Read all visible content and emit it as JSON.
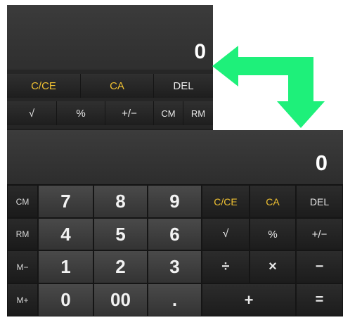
{
  "top_calc": {
    "display_value": "0",
    "row1": [
      "C/CE",
      "CA",
      "DEL"
    ],
    "row2": [
      "√",
      "%",
      "+/−",
      "CM",
      "RM"
    ]
  },
  "main_calc": {
    "display_value": "0",
    "memory": [
      "CM",
      "RM",
      "M−",
      "M+"
    ],
    "digits": {
      "r1": [
        "7",
        "8",
        "9"
      ],
      "r2": [
        "4",
        "5",
        "6"
      ],
      "r3": [
        "1",
        "2",
        "3"
      ],
      "r4": [
        "0",
        "00",
        "."
      ]
    },
    "functions": {
      "r1": [
        "C/CE",
        "CA",
        "DEL"
      ],
      "r2": [
        "√",
        "%",
        "+/−"
      ],
      "r3": [
        "÷",
        "×",
        "−"
      ],
      "r4": [
        "+",
        "="
      ]
    }
  },
  "colors": {
    "accent_yellow": "#f1c232",
    "arrow_green": "#1ef07a"
  }
}
